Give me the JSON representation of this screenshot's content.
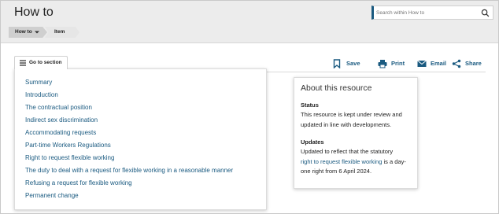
{
  "header": {
    "title": "How to",
    "search_placeholder": "Search within How to",
    "icons": {
      "search": "search-icon"
    }
  },
  "breadcrumb": {
    "items": [
      {
        "label": "How to",
        "icon": "caret-down-icon"
      },
      {
        "label": "Item"
      }
    ]
  },
  "goto_section": {
    "label": "Go to section",
    "icon": "hamburger-icon",
    "items": [
      "Summary",
      "Introduction",
      "The contractual position",
      "Indirect sex discrimination",
      "Accommodating requests",
      "Part-time Workers Regulations",
      "Right to request flexible working",
      "The duty to deal with a request for flexible working in a reasonable manner",
      "Refusing a request for flexible working",
      "Permanent change"
    ]
  },
  "actions": {
    "save": "Save",
    "print": "Print",
    "email": "Email",
    "share": "Share"
  },
  "about": {
    "title": "About this resource",
    "status_heading": "Status",
    "status_text": "This resource is kept under review and updated in line with developments.",
    "updates_heading": "Updates",
    "updates_text_1": "Updated to reflect that the statutory",
    "updates_link": "right to request flexible working",
    "updates_text_2": " is a day-one right from 6 April 2024."
  },
  "colors": {
    "link": "#1a5a80",
    "header_bg": "#ececec",
    "search_accent": "#1a5a80"
  }
}
